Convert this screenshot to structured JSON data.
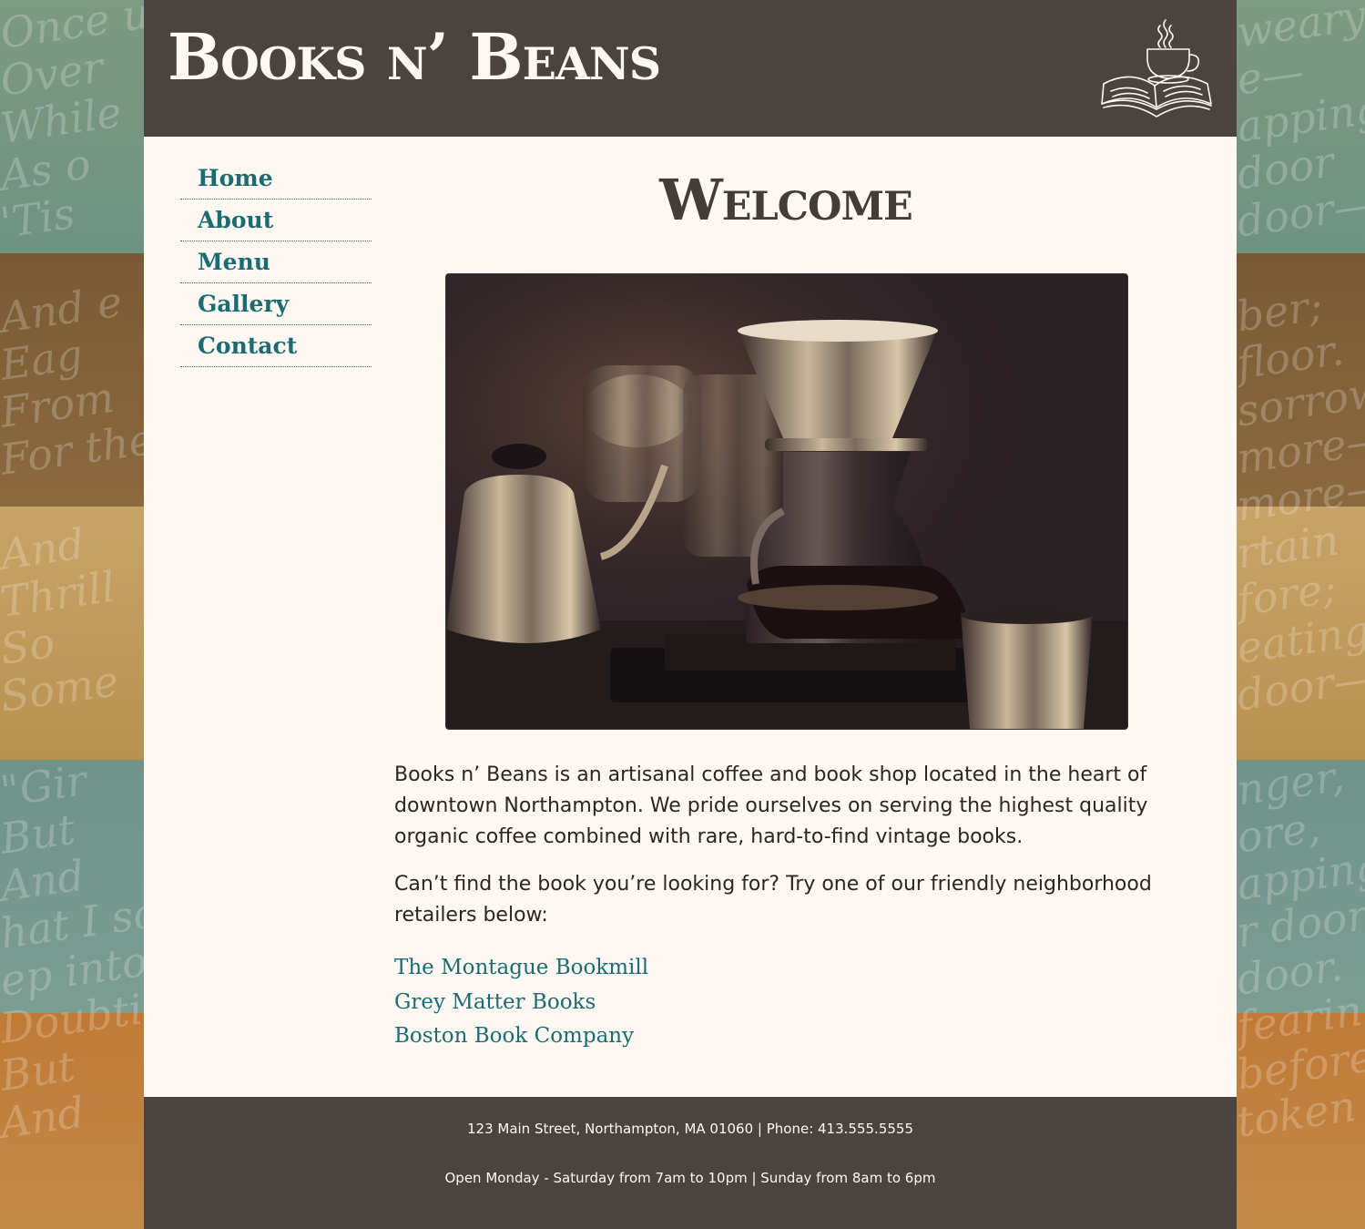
{
  "site": {
    "title": "Books n’ Beans"
  },
  "nav": {
    "items": [
      {
        "label": "Home"
      },
      {
        "label": "About"
      },
      {
        "label": "Menu"
      },
      {
        "label": "Gallery"
      },
      {
        "label": "Contact"
      }
    ]
  },
  "main": {
    "heading": "Welcome",
    "paragraph1": "Books n’ Beans is an artisanal coffee and book shop located in the heart of downtown Northampton. We pride ourselves on serving the highest quality organic coffee combined with rare, hard-to-find vintage books.",
    "paragraph2": "Can’t find the book you’re looking for? Try one of our friendly neighborhood retailers below:",
    "links": [
      {
        "label": "The Montague Bookmill"
      },
      {
        "label": "Grey Matter Books"
      },
      {
        "label": "Boston Book Company"
      }
    ]
  },
  "footer": {
    "contact": "123 Main Street, Northampton, MA 01060 | Phone: 413.555.5555",
    "hours": "Open Monday - Saturday from 7am to 10pm | Sunday from 8am to 6pm"
  },
  "icons": {
    "logo": "book-and-coffee-cup-icon"
  },
  "colors": {
    "header_bg": "#4a433f",
    "page_bg": "#fdf9f2",
    "link": "#1b6b73",
    "text": "#2c2522"
  }
}
